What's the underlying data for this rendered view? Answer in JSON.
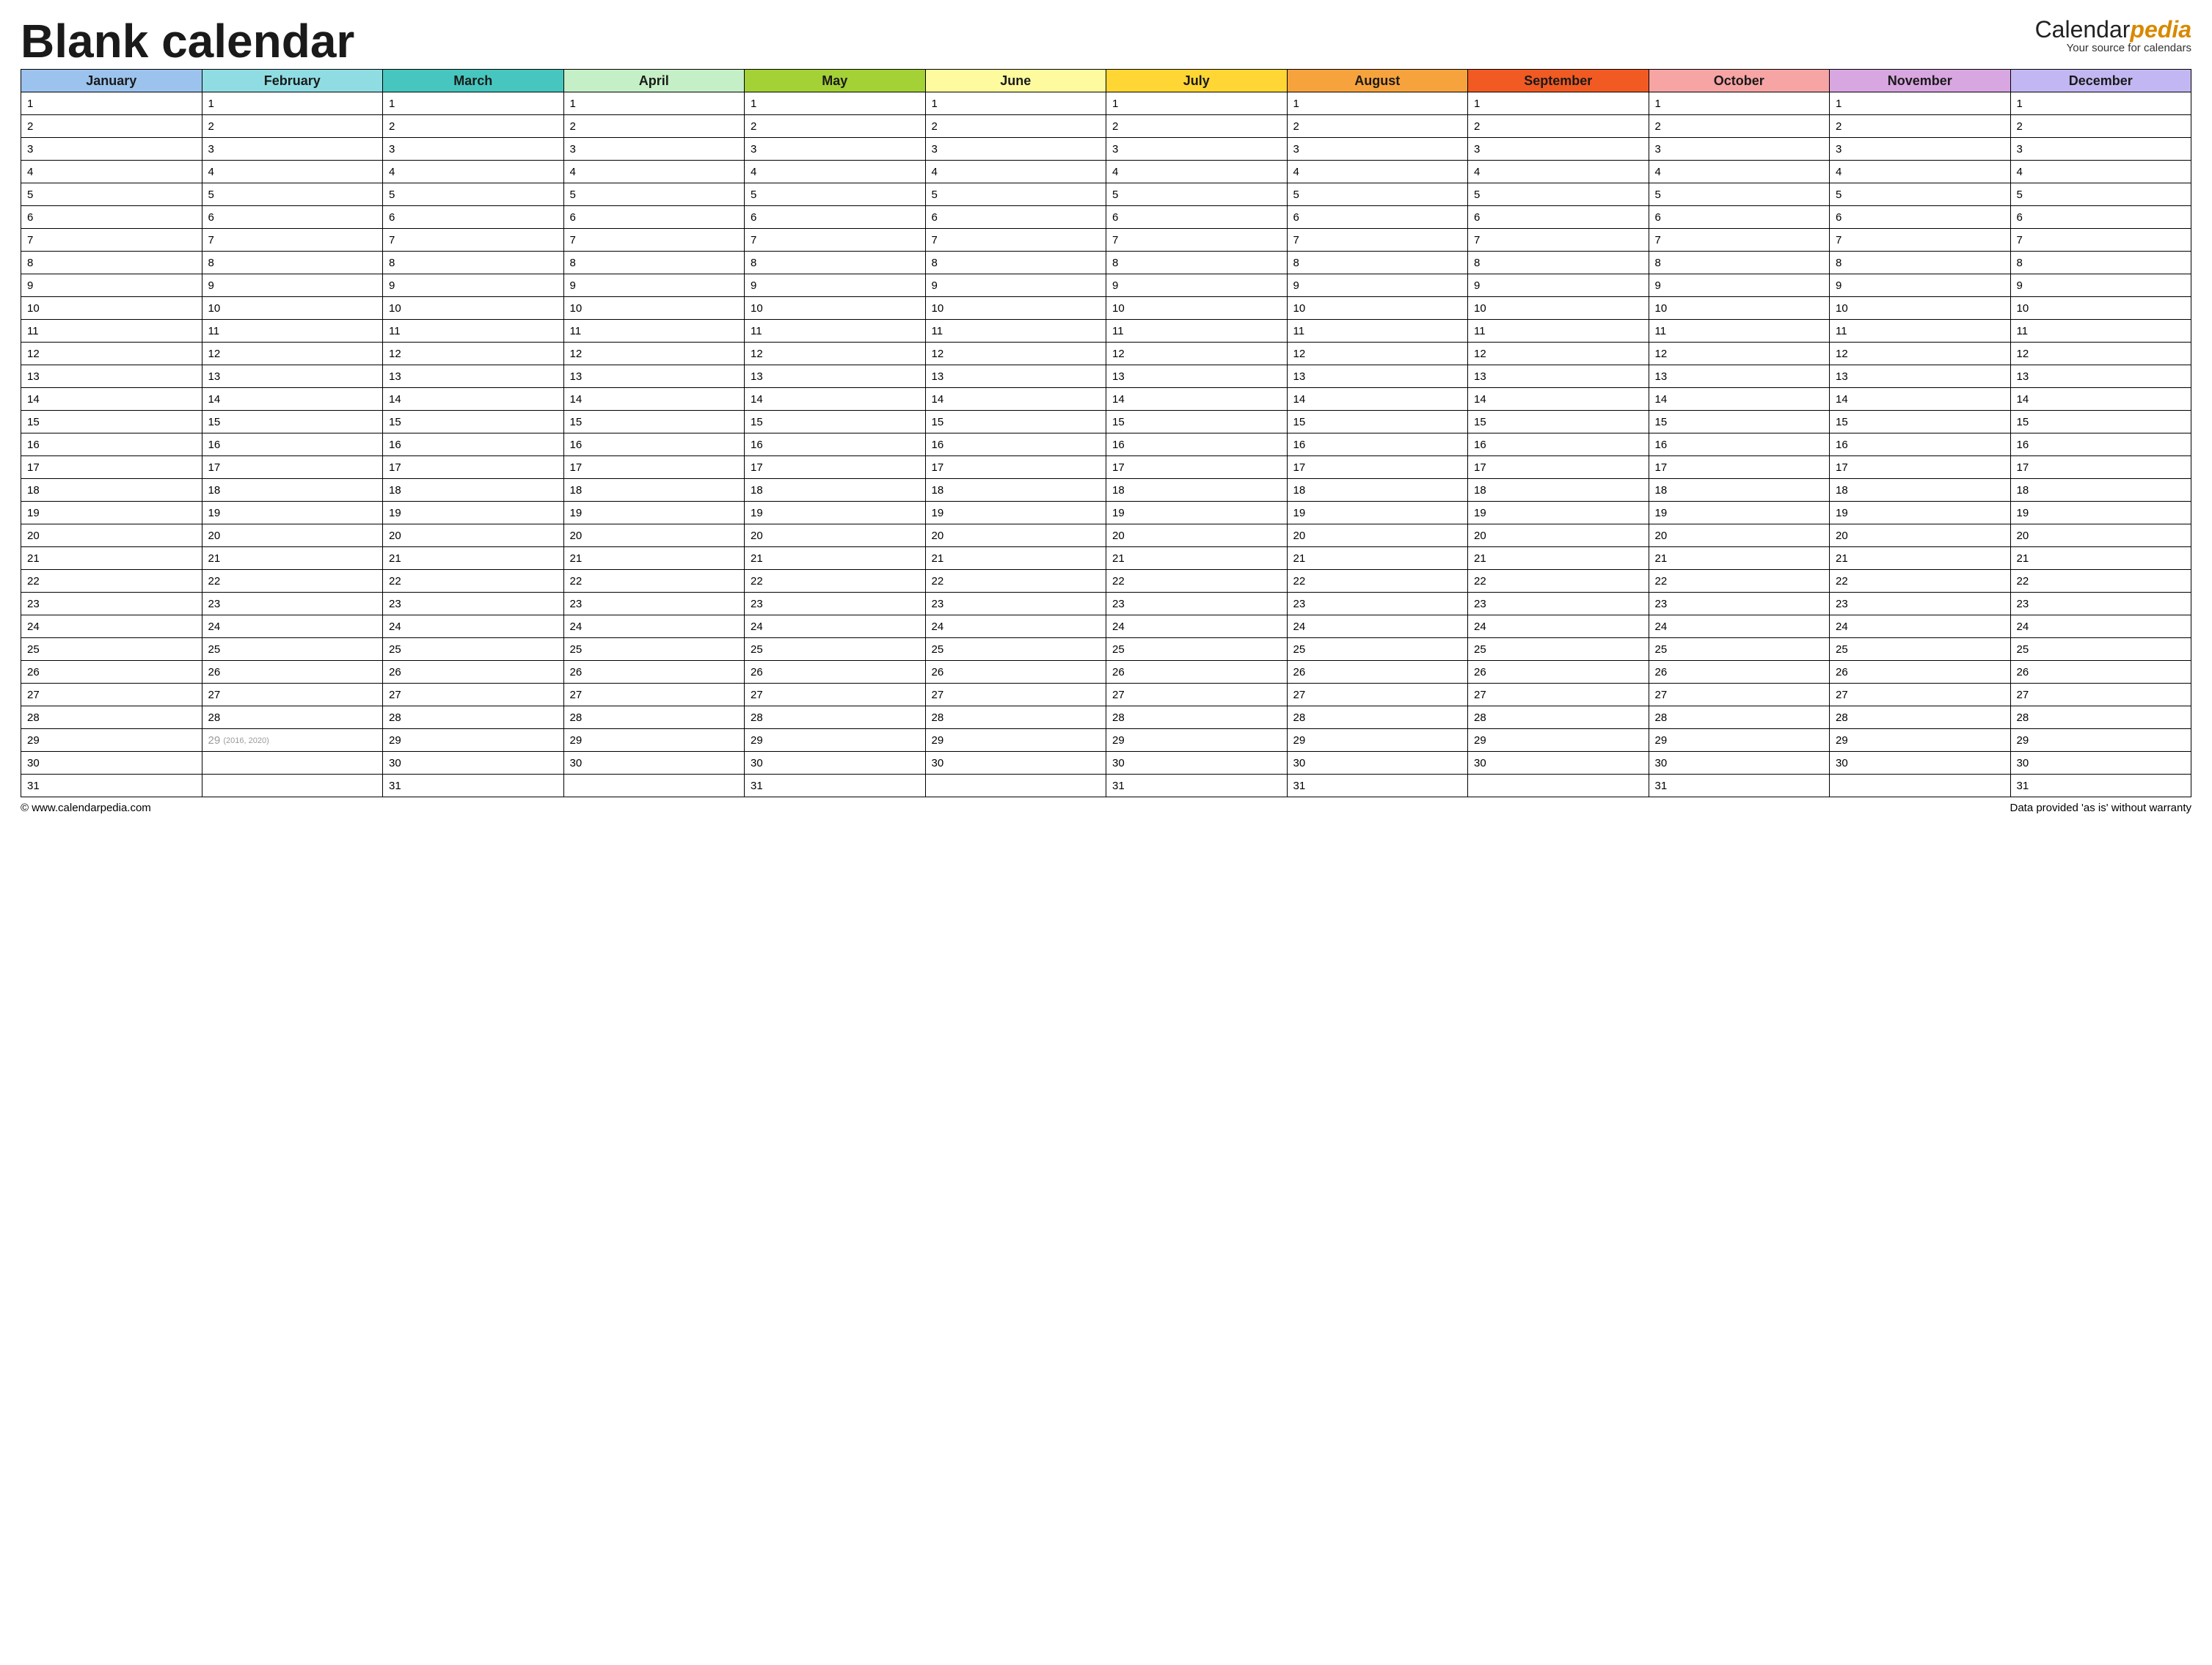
{
  "title": "Blank calendar",
  "brand": {
    "name_plain": "Calendar",
    "name_accent": "pedia",
    "tagline": "Your source for calendars"
  },
  "months": [
    {
      "name": "January",
      "color": "#9cc3ee",
      "last_day": 31
    },
    {
      "name": "February",
      "color": "#8fdde3",
      "last_day": 28,
      "leap_day": 29,
      "leap_note": "(2016, 2020)"
    },
    {
      "name": "March",
      "color": "#46c6be",
      "last_day": 31
    },
    {
      "name": "April",
      "color": "#c5efc6",
      "last_day": 30
    },
    {
      "name": "May",
      "color": "#a4d135",
      "last_day": 31
    },
    {
      "name": "June",
      "color": "#fdfb9d",
      "last_day": 30
    },
    {
      "name": "July",
      "color": "#ffd633",
      "last_day": 31
    },
    {
      "name": "August",
      "color": "#f7a33d",
      "last_day": 31
    },
    {
      "name": "September",
      "color": "#f15a22",
      "last_day": 30
    },
    {
      "name": "October",
      "color": "#f7a4a4",
      "last_day": 31
    },
    {
      "name": "November",
      "color": "#d8a6e0",
      "last_day": 30
    },
    {
      "name": "December",
      "color": "#c2b7f2",
      "last_day": 31
    }
  ],
  "max_day": 31,
  "footer": {
    "left": "© www.calendarpedia.com",
    "right": "Data provided 'as is' without warranty"
  }
}
